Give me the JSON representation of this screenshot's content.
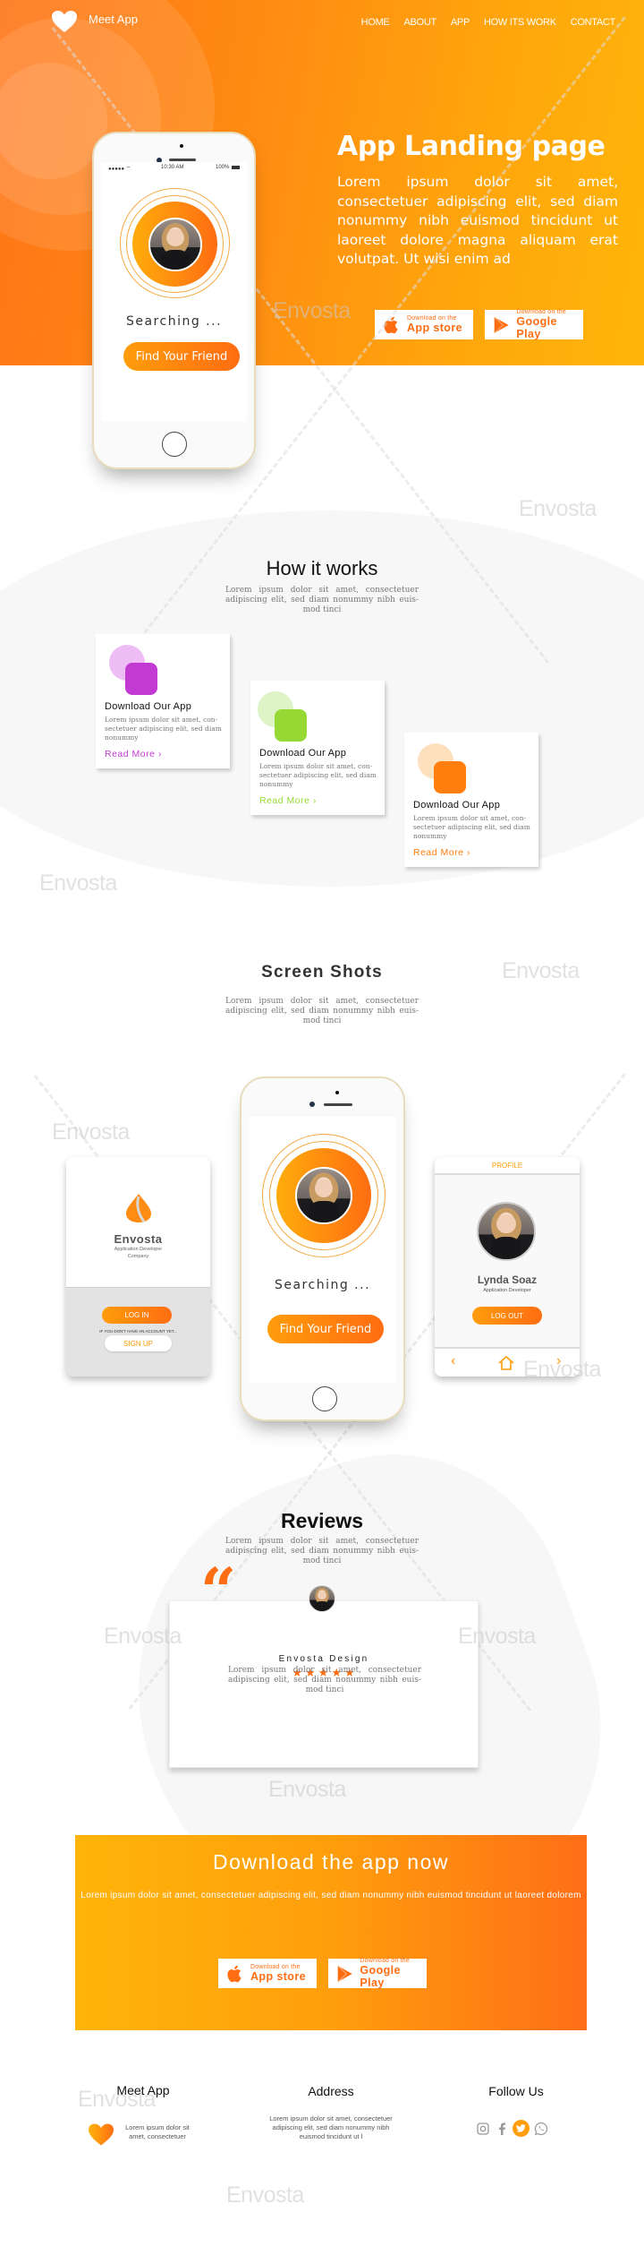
{
  "header": {
    "brand": "Meet App",
    "nav": [
      "HOME",
      "ABOUT",
      "APP",
      "HOW ITS WORK",
      "CONTACT"
    ]
  },
  "hero": {
    "title": "App Landing page",
    "text": "Lorem ipsum dolor sit amet, consectetuer adipiscing elit, sed diam nonummy nibh euismod tincidunt ut laoreet dolore magna aliquam erat volutpat. Ut wisi enim ad",
    "phone": {
      "status_time": "10:30 AM",
      "status_battery": "100%",
      "searching": "Searching ...",
      "cta": "Find Your Friend"
    },
    "app_store": {
      "small": "Download on the",
      "big": "App store"
    },
    "google_play": {
      "small": "Download on the",
      "big": "Google Play"
    }
  },
  "how_it_works": {
    "title": "How it works",
    "text": "Lorem ipsum dolor sit amet, consectetuer adipiscing elit, sed diam nonummy nibh euis-mod tinci",
    "cards": [
      {
        "title": "Download Our App",
        "text": "Lorem ipsum dolor sit amet, con-sectetuer adipiscing elit, sed diam nonummy",
        "link": "Read More",
        "accent": "#c23ad1",
        "accent_light": "#efbdf5"
      },
      {
        "title": "Download Our App",
        "text": "Lorem ipsum dolor sit amet, con-sectetuer adipiscing elit, sed diam nonummy",
        "link": "Read More",
        "accent": "#96d935",
        "accent_light": "#def3c6"
      },
      {
        "title": "Download Our App",
        "text": "Lorem ipsum dolor sit amet, con-sectetuer adipiscing elit, sed diam nonummy",
        "link": "Read More",
        "accent": "#ff7e0e",
        "accent_light": "#fde0bd"
      }
    ]
  },
  "screenshots": {
    "title": "Screen Shots",
    "text": "Lorem ipsum dolor sit amet, consectetuer adipiscing elit, sed diam nonummy nibh euis-mod tinci",
    "login": {
      "company": "Envosta",
      "subtitle_1": "Application Developer",
      "subtitle_2": "Company",
      "login": "LOG IN",
      "hint": "IF YOU DON'T HAVE AN ACCOUNT YET...",
      "signup": "SIGN UP"
    },
    "center_phone": {
      "searching": "Searching ...",
      "cta": "Find Your Friend"
    },
    "profile": {
      "header": "PROFILE",
      "name": "Lynda Soaz",
      "role": "Application Developer",
      "logout": "LOG OUT"
    }
  },
  "reviews": {
    "title": "Reviews",
    "text": "Lorem ipsum dolor sit amet, consectetuer adipiscing elit, sed diam nonummy nibh euis-mod tinci",
    "reviewer": "Envosta Design",
    "rating": 5,
    "rating_max": 5,
    "review_text": "Lorem ipsum dolor sit amet, consectetuer adipiscing elit, sed diam nonummy nibh euis-mod tinci"
  },
  "download": {
    "title": "Download the app now",
    "text": "Lorem ipsum dolor sit amet, consectetuer adipiscing elit, sed diam nonummy nibh euismod tincidunt ut laoreet dolorem",
    "app_store": {
      "small": "Download on the",
      "big": "App store"
    },
    "google_play": {
      "small": "Download on the",
      "big": "Google Play"
    }
  },
  "footer": {
    "col1_title": "Meet App",
    "col1_text": "Lorem ipsum dolor sit amet, consectetuer",
    "col2_title": "Address",
    "col2_text": "Lorem ipsum dolor sit amet, consectetuer adipiscing elit, sed diam nonummy nibh euismod tincidunt ut l",
    "col3_title": "Follow Us",
    "social": [
      "instagram",
      "facebook",
      "twitter",
      "whatsapp"
    ]
  },
  "watermark": "Envosta",
  "colors": {
    "orange": "#ff6d12",
    "amber": "#ffb40a",
    "text_gray": "#777777"
  }
}
